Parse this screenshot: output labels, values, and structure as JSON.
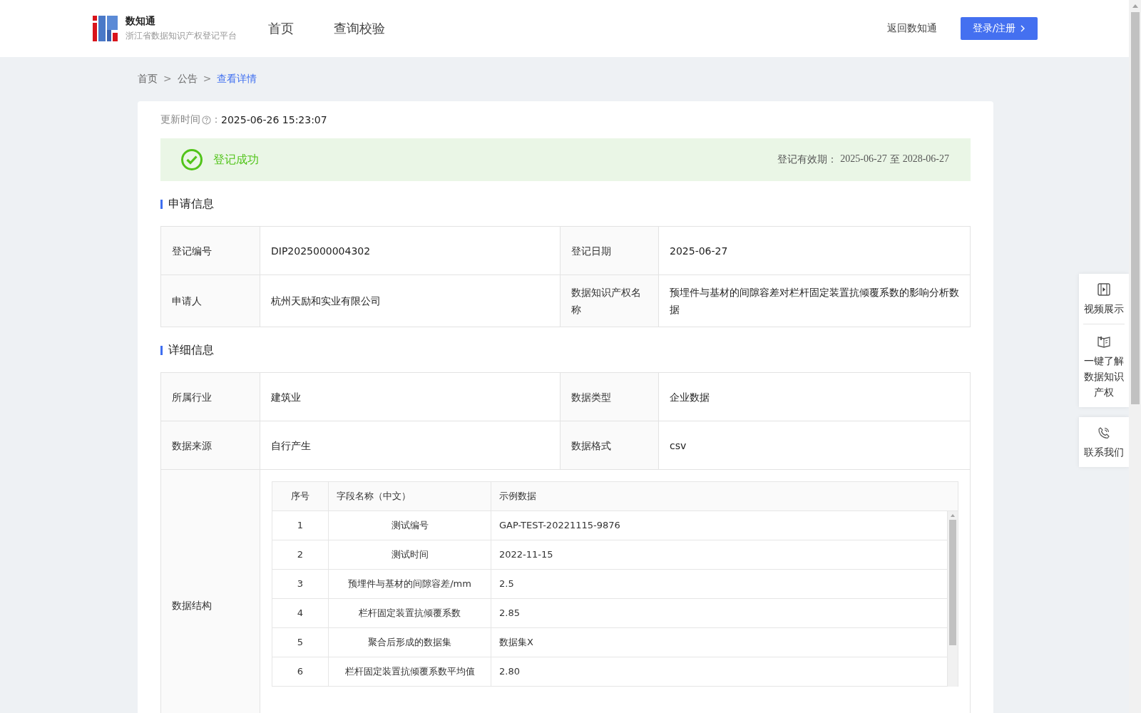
{
  "header": {
    "logo": {
      "title": "数知通",
      "subtitle": "浙江省数据知识产权登记平台"
    },
    "nav": [
      {
        "label": "首页",
        "selected": false
      },
      {
        "label": "查询校验",
        "selected": false
      }
    ],
    "back_link": "返回数知通",
    "login_button": "登录/注册"
  },
  "breadcrumb": {
    "separator": ">",
    "items": [
      {
        "label": "首页",
        "selected": false
      },
      {
        "label": "公告",
        "selected": false
      },
      {
        "label": "查看详情",
        "selected": true
      }
    ]
  },
  "update": {
    "label": "更新时间",
    "separator": "：",
    "value": "2025-06-26 15:23:07"
  },
  "status": {
    "kind": "success",
    "label": "登记成功",
    "validity_label": "登记有效期：",
    "start": "2025-06-27",
    "to": "至",
    "end": "2028-06-27"
  },
  "sections": [
    {
      "title": "申请信息",
      "rows": [
        [
          {
            "label": "登记编号",
            "value": "DIP2025000004302"
          },
          {
            "label": "登记日期",
            "value": "2025-06-27"
          }
        ],
        [
          {
            "label": "申请人",
            "value": "杭州天励和实业有限公司"
          },
          {
            "label": "数据知识产权名称",
            "value": "预埋件与基材的间隙容差对栏杆固定装置抗倾覆系数的影响分析数据"
          }
        ]
      ]
    },
    {
      "title": "详细信息",
      "rows": [
        [
          {
            "label": "所属行业",
            "value": "建筑业"
          },
          {
            "label": "数据类型",
            "value": "企业数据"
          }
        ],
        [
          {
            "label": "数据来源",
            "value": "自行产生"
          },
          {
            "label": "数据格式",
            "value": "csv"
          }
        ]
      ],
      "structure": {
        "label": "数据结构",
        "columns": [
          "序号",
          "字段名称（中文）",
          "示例数据"
        ],
        "rows": [
          [
            "1",
            "测试编号",
            "GAP-TEST-20221115-9876"
          ],
          [
            "2",
            "测试时间",
            "2022-11-15"
          ],
          [
            "3",
            "预埋件与基材的间隙容差/mm",
            "2.5"
          ],
          [
            "4",
            "栏杆固定装置抗倾覆系数",
            "2.85"
          ],
          [
            "5",
            "聚合后形成的数据集",
            "数据集X"
          ],
          [
            "6",
            "栏杆固定装置抗倾覆系数平均值",
            "2.80"
          ]
        ]
      }
    }
  ],
  "side_panel": [
    {
      "kind": "video",
      "label": "视频展示"
    },
    {
      "kind": "book",
      "label": "一键了解数据知识产权"
    },
    {
      "kind": "phone",
      "label": "联系我们"
    }
  ]
}
